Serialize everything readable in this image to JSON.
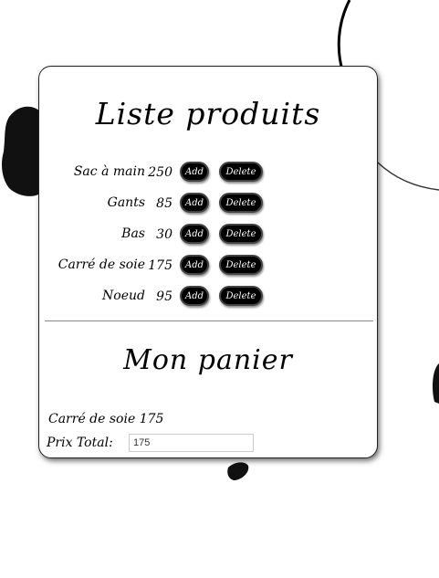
{
  "products_panel": {
    "title": "Liste produits",
    "add_label": "Add",
    "delete_label": "Delete",
    "items": [
      {
        "name": "Sac à main",
        "price": "250"
      },
      {
        "name": "Gants",
        "price": "85"
      },
      {
        "name": "Bas",
        "price": "30"
      },
      {
        "name": "Carré de soie",
        "price": "175"
      },
      {
        "name": "Noeud",
        "price": "95"
      }
    ]
  },
  "cart_panel": {
    "title": "Mon panier",
    "items": [
      {
        "name": "Carré de soie",
        "price": "175"
      }
    ],
    "total_label": "Prix Total:",
    "total_value": "175"
  },
  "colors": {
    "button_bg": "#000000",
    "button_text": "#ffffff",
    "panel_bg": "#ffffff",
    "ink": "#000000"
  }
}
